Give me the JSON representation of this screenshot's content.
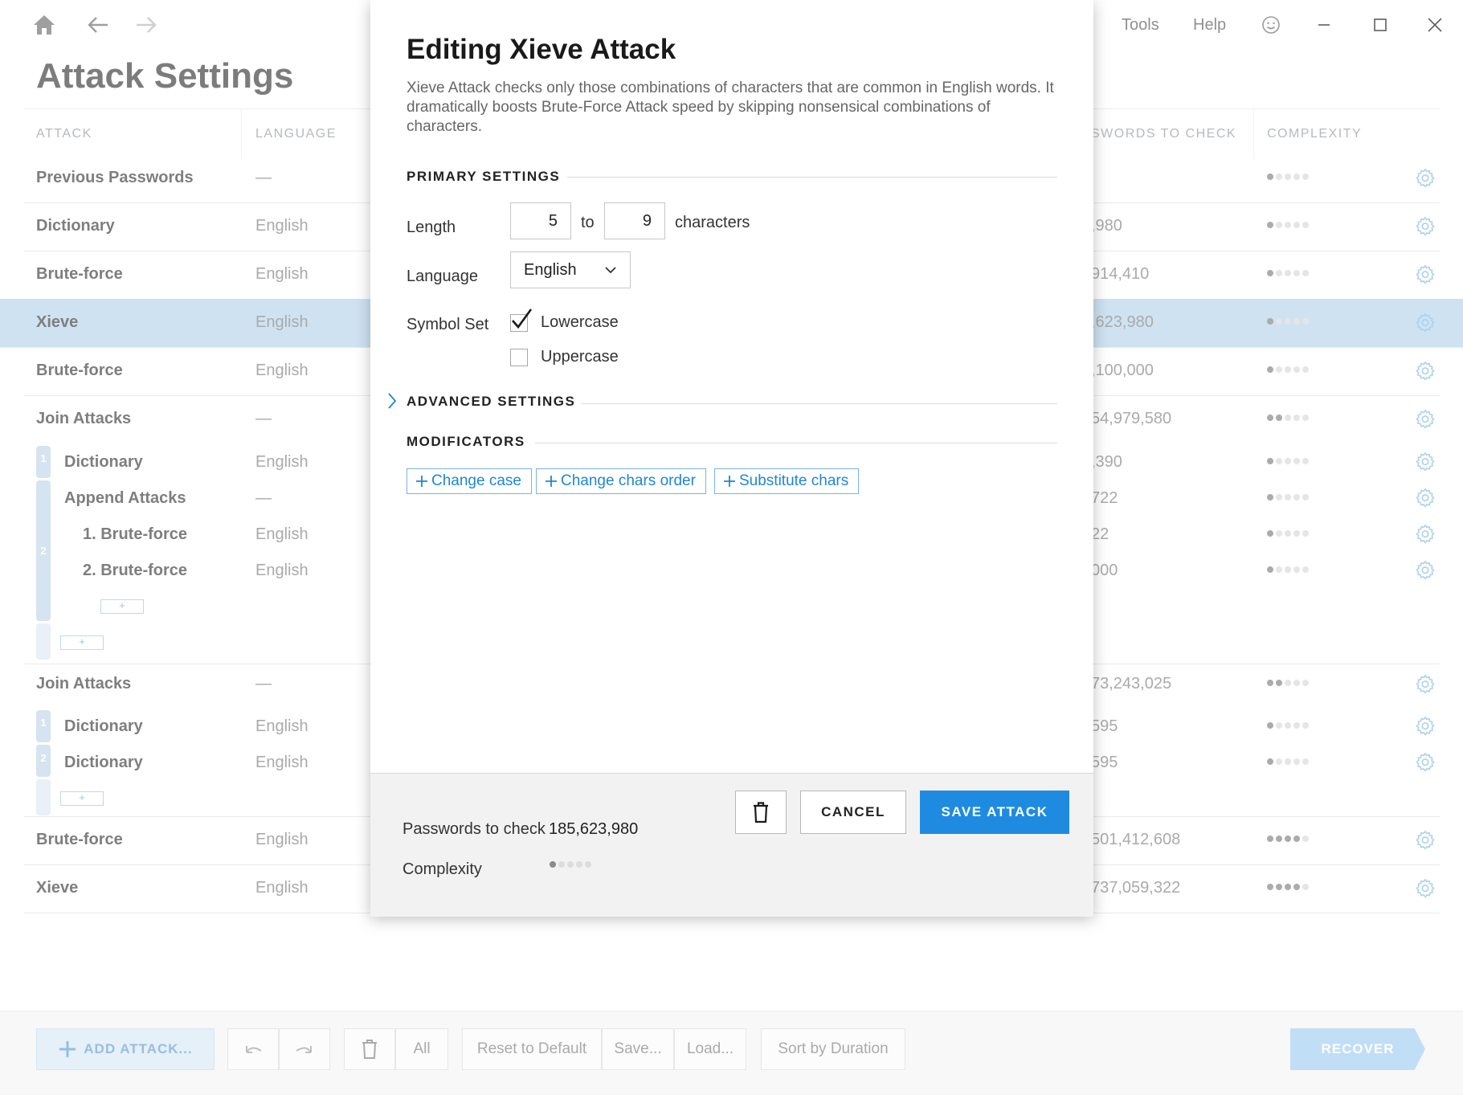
{
  "titlebar": {
    "page_title": "Attack Settings",
    "menu": [
      "Tools",
      "Help"
    ]
  },
  "table": {
    "headers": [
      "ATTACK",
      "LANGUAGE",
      "SWORDS TO CHECK",
      "COMPLEXITY"
    ],
    "rows": [
      {
        "name": "Previous Passwords",
        "lang": "—",
        "pw": "",
        "complexity": 1
      },
      {
        "name": "Dictionary",
        "lang": "English",
        "pw": ",980",
        "complexity": 1
      },
      {
        "name": "Brute-force",
        "lang": "English",
        "pw": "914,410",
        "complexity": 1
      },
      {
        "name": "Xieve",
        "lang": "English",
        "pw": ",623,980",
        "complexity": 1
      },
      {
        "name": "Brute-force",
        "lang": "English",
        "pw": ",100,000",
        "complexity": 1
      },
      {
        "name": "Join Attacks",
        "lang": "—",
        "pw": "54,979,580",
        "complexity": 2
      },
      {
        "name": "Dictionary",
        "lang": "English",
        "pw": ",390",
        "complexity": 1
      },
      {
        "name": "Append Attacks",
        "lang": "—",
        "pw": "722",
        "complexity": 1
      },
      {
        "name": "1. Brute-force",
        "lang": "English",
        "pw": "22",
        "complexity": 1
      },
      {
        "name": "2. Brute-force",
        "lang": "English",
        "pw": "000",
        "complexity": 1
      },
      {
        "name": "Join Attacks",
        "lang": "—",
        "pw": "73,243,025",
        "complexity": 2
      },
      {
        "name": "Dictionary",
        "lang": "English",
        "pw": "595",
        "complexity": 1
      },
      {
        "name": "Dictionary",
        "lang": "English",
        "pw": "595",
        "complexity": 1
      },
      {
        "name": "Brute-force",
        "lang": "English",
        "pw": "501,412,608",
        "complexity": 4
      },
      {
        "name": "Xieve",
        "lang": "English",
        "pw": "737,059,322",
        "complexity": 4
      }
    ],
    "group_numbers": [
      "1",
      "2",
      "1",
      "2"
    ],
    "mini_add": "+"
  },
  "toolbar": {
    "add_attack": "ADD ATTACK...",
    "all": "All",
    "reset": "Reset to Default",
    "save": "Save...",
    "load": "Load...",
    "sort": "Sort by Duration",
    "recover": "RECOVER"
  },
  "dialog": {
    "title": "Editing Xieve Attack",
    "description": "Xieve Attack checks only those combinations of characters that are common in English words. It dramatically boosts Brute-Force Attack speed by skipping nonsensical combinations of characters.",
    "primary_settings": "PRIMARY SETTINGS",
    "length_label": "Length",
    "length_from": "5",
    "length_to_word": "to",
    "length_to": "9",
    "length_unit": "characters",
    "language_label": "Language",
    "language_value": "English",
    "symbol_set_label": "Symbol Set",
    "lowercase_label": "Lowercase",
    "lowercase_checked": true,
    "uppercase_label": "Uppercase",
    "uppercase_checked": false,
    "advanced_settings": "ADVANCED SETTINGS",
    "modificators": "MODIFICATORS",
    "modificator_buttons": [
      "Change case",
      "Change chars order",
      "Substitute chars"
    ],
    "footer": {
      "passwords_label": "Passwords to check",
      "passwords_value": "185,623,980",
      "complexity_label": "Complexity",
      "complexity_level": 1,
      "cancel": "CANCEL",
      "save": "SAVE ATTACK"
    }
  },
  "colors": {
    "accent": "#1f8be0",
    "selected_row": "#bcd7ee",
    "gear": "#8ec0ea"
  }
}
